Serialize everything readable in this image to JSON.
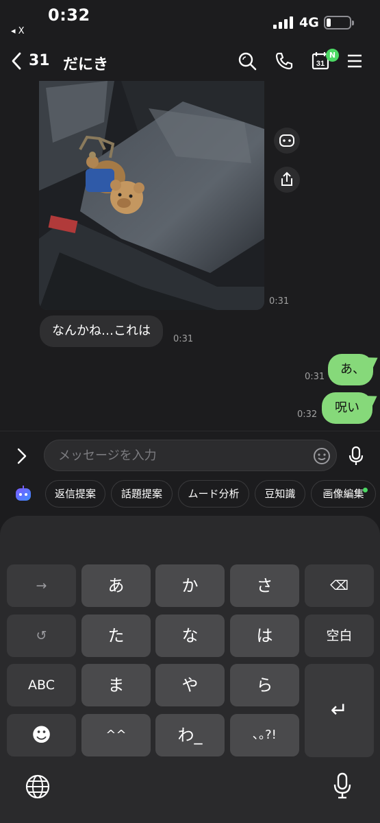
{
  "status_bar": {
    "time": "0:32",
    "back_app": "◂ X",
    "network": "4G"
  },
  "header": {
    "unread_count": "31",
    "title": "だにき",
    "calendar_day": "31",
    "calendar_badge": "N"
  },
  "messages": [
    {
      "type": "image",
      "side": "in",
      "time": "0:31"
    },
    {
      "type": "text",
      "side": "in",
      "text": "なんかね…これは",
      "time": "0:31"
    },
    {
      "type": "text",
      "side": "out",
      "text": "あ、",
      "time": "0:31"
    },
    {
      "type": "text",
      "side": "out",
      "text": "呪い",
      "time": "0:32"
    }
  ],
  "input": {
    "placeholder": "メッセージを入力"
  },
  "suggestions": [
    "返信提案",
    "話題提案",
    "ムード分析",
    "豆知識",
    "画像編集"
  ],
  "keyboard": {
    "row1": [
      "→",
      "あ",
      "か",
      "さ",
      "⌫"
    ],
    "row2": [
      "↺",
      "た",
      "な",
      "は",
      "空白"
    ],
    "row3": [
      "ABC",
      "ま",
      "や",
      "ら",
      "↵"
    ],
    "row4": [
      "☻",
      "^^",
      "わ_",
      "､｡?!"
    ]
  },
  "colors": {
    "accent_green": "#86d97a",
    "badge_green": "#4cd964",
    "background": "#1c1c1e"
  }
}
